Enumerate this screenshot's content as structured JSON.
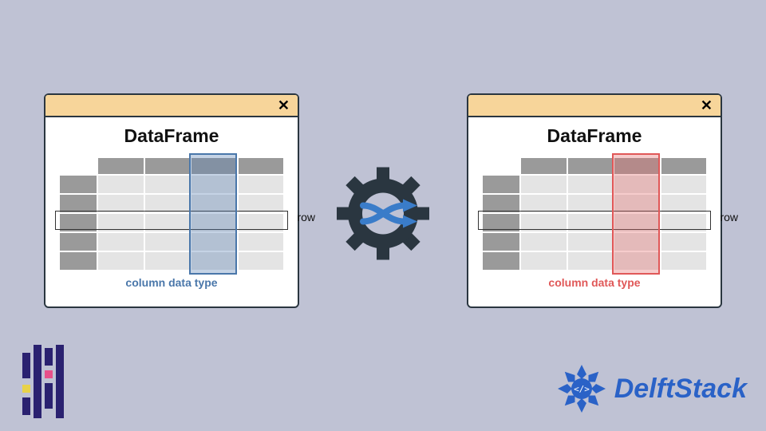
{
  "leftPanel": {
    "title": "DataFrame",
    "rowLabel": "row",
    "columnLabel": "column data type",
    "closeGlyph": "✕",
    "highlightColor": "#4a77aa"
  },
  "rightPanel": {
    "title": "DataFrame",
    "rowLabel": "row",
    "columnLabel": "column data type",
    "closeGlyph": "✕",
    "highlightColor": "#e05858"
  },
  "branding": {
    "rightLogoText": "DelftStack"
  },
  "chart_data": {
    "type": "diagram",
    "description": "Two DataFrame window illustrations connected by a gear/shuffle transform icon, indicating a column data type change from one DataFrame (blue highlight) to another (red highlight).",
    "meaning": "pandas DataFrame column dtype conversion / transformation"
  }
}
